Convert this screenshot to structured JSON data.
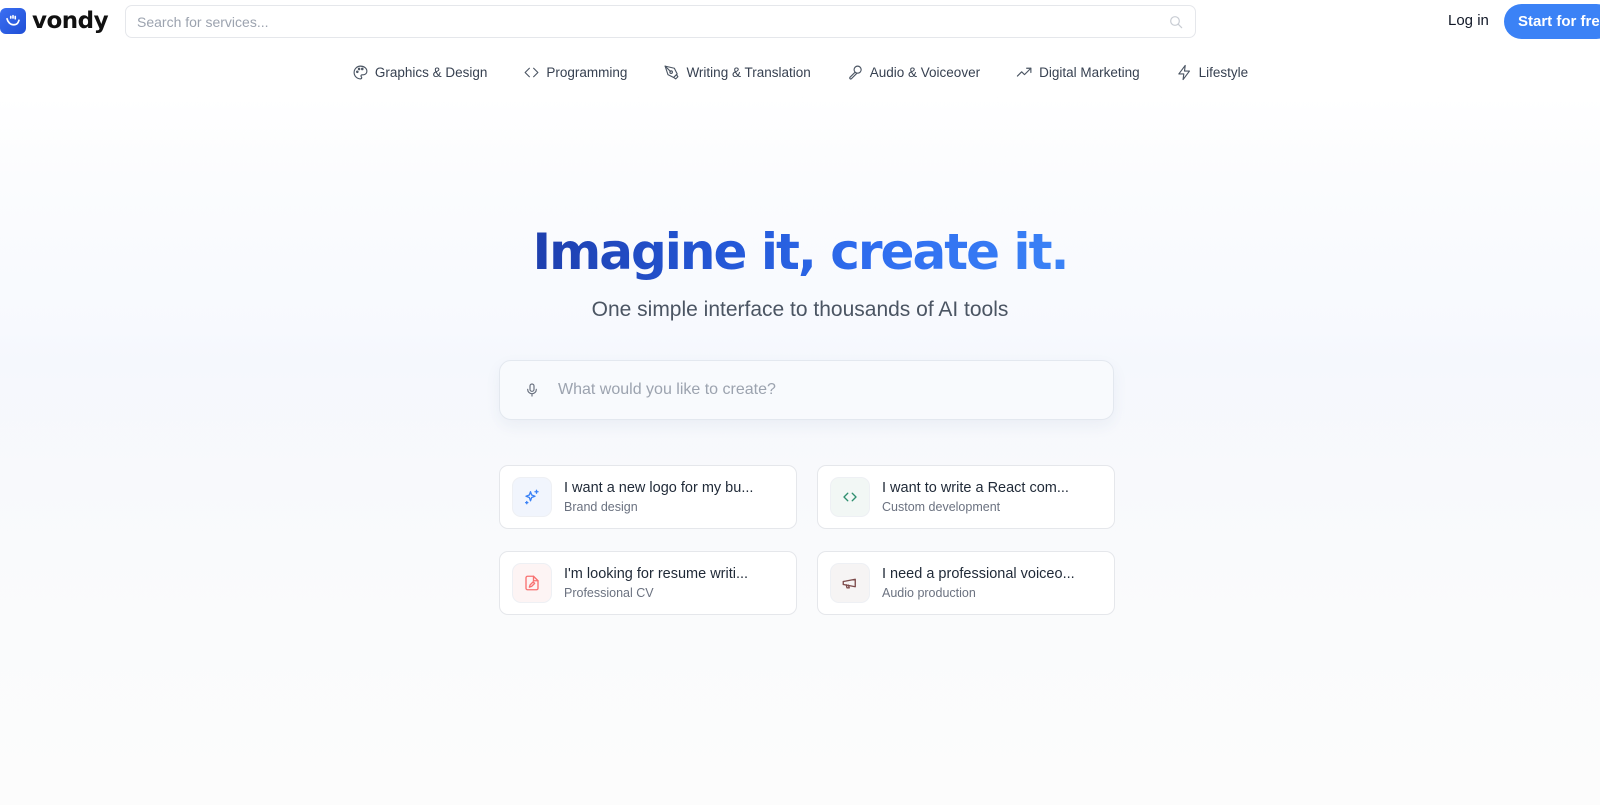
{
  "header": {
    "logo_text": "vondy",
    "logo_icon": "shaka-hand-icon",
    "search_placeholder": "Search for services...",
    "search_icon": "search-icon",
    "login_label": "Log in",
    "start_label": "Start for free"
  },
  "categories": [
    {
      "label": "Graphics & Design",
      "icon": "palette-icon"
    },
    {
      "label": "Programming",
      "icon": "code-icon"
    },
    {
      "label": "Writing & Translation",
      "icon": "pen-tool-icon"
    },
    {
      "label": "Audio & Voiceover",
      "icon": "microphone-icon"
    },
    {
      "label": "Digital Marketing",
      "icon": "trending-up-icon"
    },
    {
      "label": "Lifestyle",
      "icon": "lightning-icon"
    }
  ],
  "hero": {
    "title": "Imagine it, create it.",
    "subtitle": "One simple interface to thousands of AI tools",
    "create_placeholder": "What would you like to create?",
    "create_icon": "microphone-icon"
  },
  "suggestions": [
    {
      "title": "I want a new logo for my bu...",
      "subtitle": "Brand design",
      "icon": "sparkles-icon",
      "color": "#3b82f6",
      "bg": "#f1f5fd"
    },
    {
      "title": "I want to write a React com...",
      "subtitle": "Custom development",
      "icon": "code-icon",
      "color": "#2f8f6f",
      "bg": "#f2f7f5"
    },
    {
      "title": "I'm looking for resume writi...",
      "subtitle": "Professional CV",
      "icon": "file-edit-icon",
      "color": "#f87171",
      "bg": "#fdf4f4"
    },
    {
      "title": "I need a professional voiceo...",
      "subtitle": "Audio production",
      "icon": "megaphone-icon",
      "color": "#7c4a4a",
      "bg": "#f6f4f4"
    }
  ],
  "colors": {
    "accent": "#3b82f6",
    "title_gradient_start": "#1e3fae",
    "title_gradient_end": "#3b82f6"
  }
}
